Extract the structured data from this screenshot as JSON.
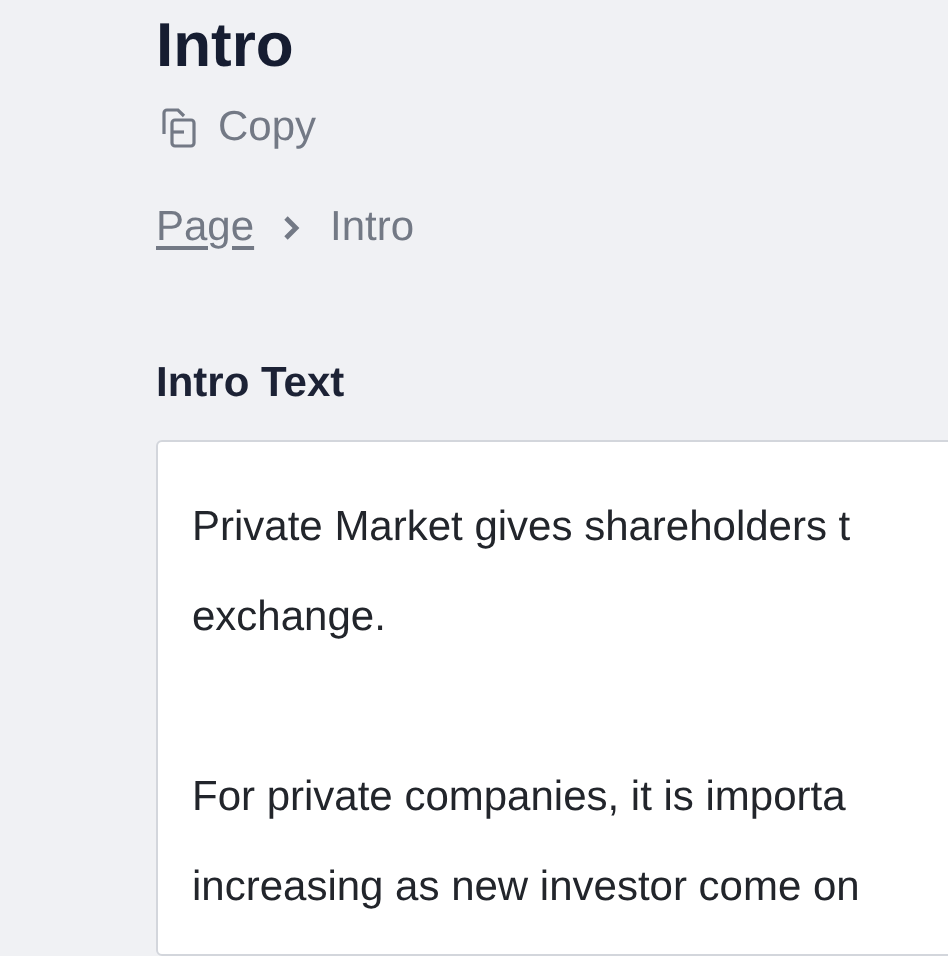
{
  "title": "Intro",
  "copy_button": {
    "label": "Copy"
  },
  "breadcrumb": [
    {
      "label": "Page",
      "kind": "link"
    },
    {
      "label": "Intro",
      "kind": "current"
    }
  ],
  "field": {
    "label": "Intro Text",
    "paragraphs": [
      [
        "Private Market gives shareholders t",
        "exchange."
      ],
      [
        "For private companies, it is importa",
        "increasing as new investor come on"
      ]
    ]
  }
}
